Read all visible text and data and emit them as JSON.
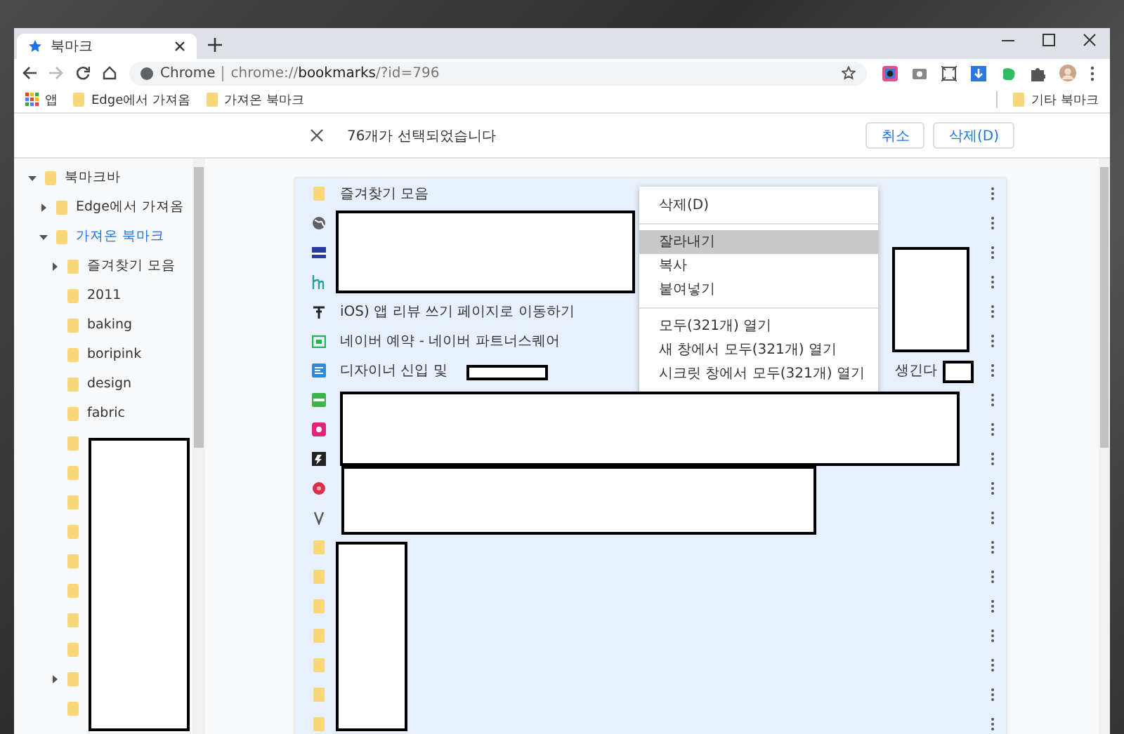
{
  "window": {
    "tab": {
      "title": "북마크",
      "selected": true
    }
  },
  "toolbar": {
    "site_label": "Chrome",
    "url": "chrome://**bookmarks**/?id=796"
  },
  "bookmarks_bar": {
    "items": [
      {
        "kind": "apps",
        "label": "앱"
      },
      {
        "kind": "folder",
        "label": "Edge에서 가져옴"
      },
      {
        "kind": "folder",
        "label": "가져온 북마크"
      }
    ],
    "other": {
      "kind": "folder",
      "label": "기타 북마크"
    }
  },
  "selection_bar": {
    "message": "76개가 선택되었습니다",
    "buttons": [
      {
        "label": "취소"
      },
      {
        "label": "삭제(D)"
      }
    ]
  },
  "sidebar": {
    "items": [
      {
        "kind": "folder",
        "name": "북마크바",
        "selected": false,
        "expanded": true,
        "children": [
          {
            "kind": "folder",
            "name": "Edge에서 가져옴",
            "selected": false,
            "expanded": false
          },
          {
            "kind": "folder",
            "name": "가져온 북마크",
            "selected": true,
            "expanded": true,
            "children": [
              {
                "kind": "folder",
                "name": "즐겨찾기 모음",
                "selected": false,
                "expanded": false
              },
              {
                "kind": "folder",
                "name": "2011",
                "selected": false
              },
              {
                "kind": "folder",
                "name": "baking",
                "selected": false
              },
              {
                "kind": "folder",
                "name": "boripink",
                "selected": false
              },
              {
                "kind": "folder",
                "name": "design",
                "selected": false
              },
              {
                "kind": "folder",
                "name": "fabric",
                "selected": false
              },
              {
                "kind": "folder"
              },
              {
                "kind": "folder"
              },
              {
                "kind": "folder"
              },
              {
                "kind": "folder"
              },
              {
                "kind": "folder"
              },
              {
                "kind": "folder"
              },
              {
                "kind": "folder"
              },
              {
                "kind": "folder"
              },
              {
                "kind": "folder",
                "expanded": false
              },
              {
                "kind": "folder"
              }
            ]
          }
        ]
      }
    ]
  },
  "list": {
    "rows": [
      {
        "kind": "folder",
        "title": "즐겨찾기 모음",
        "selected": true
      },
      {
        "kind": "bookmark",
        "selected": true
      },
      {
        "kind": "bookmark",
        "selected": true
      },
      {
        "kind": "bookmark",
        "selected": true
      },
      {
        "kind": "bookmark",
        "title": "iOS) 앱 리뷰 쓰기 페이지로 이동하기",
        "selected": true
      },
      {
        "kind": "bookmark",
        "title": "네이버 예약 - 네이버 파트너스퀘어",
        "selected": true
      },
      {
        "kind": "bookmark",
        "title": "디자이너 신입 및",
        "title_end": "생긴다",
        "selected": true
      },
      {
        "kind": "bookmark",
        "selected": true
      },
      {
        "kind": "bookmark",
        "selected": true
      },
      {
        "kind": "bookmark",
        "selected": true
      },
      {
        "kind": "bookmark",
        "selected": true
      },
      {
        "kind": "bookmark",
        "selected": true
      },
      {
        "kind": "folder",
        "selected": true
      },
      {
        "kind": "folder",
        "selected": true
      },
      {
        "kind": "folder",
        "selected": true
      },
      {
        "kind": "folder",
        "selected": true
      },
      {
        "kind": "folder",
        "selected": true
      },
      {
        "kind": "folder",
        "selected": true
      },
      {
        "kind": "folder",
        "selected": true
      }
    ]
  },
  "context_menu": {
    "groups": [
      [
        {
          "label": "삭제(D)",
          "selected": false
        }
      ],
      [
        {
          "label": "잘라내기",
          "selected": true
        },
        {
          "label": "복사",
          "selected": false
        },
        {
          "label": "붙여넣기",
          "selected": false
        }
      ],
      [
        {
          "label": "모두(321개) 열기",
          "selected": false
        },
        {
          "label": "새 창에서 모두(321개) 열기",
          "selected": false
        },
        {
          "label": "시크릿 창에서 모두(321개) 열기",
          "selected": false
        }
      ]
    ]
  }
}
